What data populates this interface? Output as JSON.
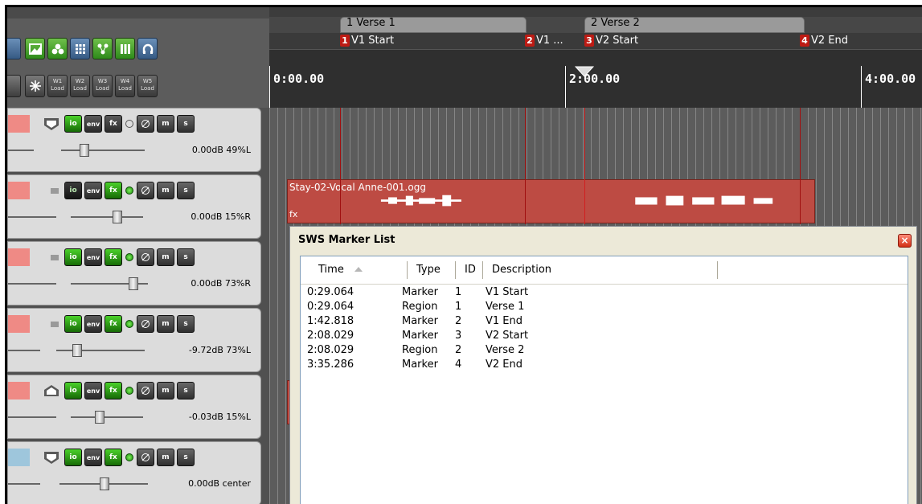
{
  "toolbar": {
    "load_buttons": [
      {
        "top": "W1",
        "bottom": "Load"
      },
      {
        "top": "W2",
        "bottom": "Load"
      },
      {
        "top": "W3",
        "bottom": "Load"
      },
      {
        "top": "W4",
        "bottom": "Load"
      },
      {
        "top": "W5",
        "bottom": "Load"
      }
    ]
  },
  "track_buttons": {
    "io": "io",
    "env": "env",
    "fx": "fx",
    "m": "m",
    "s": "s"
  },
  "tracks": [
    {
      "value": "0.00dB 49%L"
    },
    {
      "value": "0.00dB 15%R"
    },
    {
      "value": "0.00dB 73%R"
    },
    {
      "value": "-9.72dB 73%L"
    },
    {
      "value": "-0.03dB 15%L"
    },
    {
      "value": "0.00dB center"
    }
  ],
  "regions": [
    {
      "label": "1 Verse 1"
    },
    {
      "label": "2 Verse 2"
    }
  ],
  "markers": [
    {
      "num": "1",
      "name": "V1 Start"
    },
    {
      "num": "2",
      "name": "V1 ..."
    },
    {
      "num": "3",
      "name": "V2 Start"
    },
    {
      "num": "4",
      "name": "V2 End"
    }
  ],
  "ruler": {
    "labels": [
      "0:00.00",
      "2:00.00",
      "4:00.00"
    ]
  },
  "item": {
    "title": "Stay-02-Vocal Anne-001.ogg",
    "fx_label": "fx"
  },
  "sws": {
    "title": "SWS Marker List",
    "close": "×",
    "columns": {
      "time": "Time",
      "type": "Type",
      "id": "ID",
      "description": "Description"
    },
    "rows": [
      {
        "time": "0:29.064",
        "type": "Marker",
        "id": "1",
        "description": "V1 Start"
      },
      {
        "time": "0:29.064",
        "type": "Region",
        "id": "1",
        "description": "Verse 1"
      },
      {
        "time": "1:42.818",
        "type": "Marker",
        "id": "2",
        "description": "V1 End"
      },
      {
        "time": "2:08.029",
        "type": "Marker",
        "id": "3",
        "description": "V2 Start"
      },
      {
        "time": "2:08.029",
        "type": "Region",
        "id": "2",
        "description": "Verse 2"
      },
      {
        "time": "3:35.286",
        "type": "Marker",
        "id": "4",
        "description": "V2 End"
      }
    ]
  },
  "colors": {
    "marker": "#bd1b14",
    "item": "#bd4b43",
    "track_red": "#ef8a85",
    "track_blue": "#9ec6dc"
  }
}
